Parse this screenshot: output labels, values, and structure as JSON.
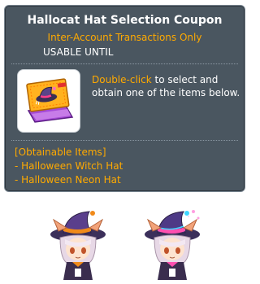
{
  "tooltip": {
    "title": "Hallocat Hat Selection Coupon",
    "subtitle": "Inter-Account Transactions Only",
    "usable_until": "USABLE UNTIL",
    "description_highlight": "Double-click",
    "description_rest": " to select and obtain one of the items below.",
    "obtainable_header": "[Obtainable Items]",
    "items": [
      "- Halloween Witch Hat",
      "- Halloween Neon Hat"
    ],
    "item_icon": "hat-coupon-icon"
  },
  "avatars": [
    {
      "name": "witch-hat-avatar"
    },
    {
      "name": "neon-hat-avatar"
    }
  ],
  "colors": {
    "background": "#4a5660",
    "accent": "#ffaa00",
    "text": "#ffffff"
  }
}
